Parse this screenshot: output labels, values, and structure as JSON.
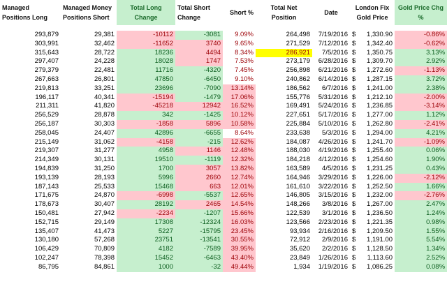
{
  "headers": {
    "long": "Managed Positions Long",
    "short": "Managed Money Positions Short",
    "total_long_change": "Total Long Change",
    "total_short_change": "Total Short Change",
    "short_pct": "Short %",
    "total_net": "Total Net Position",
    "date": "Date",
    "london_fix": "London Fix Gold Price",
    "gold_chg": "Gold Price Chg %"
  },
  "rows": [
    {
      "long": "293,879",
      "short": "29,381",
      "tlc": "-10112",
      "tsc": "-3081",
      "pct": "9.09%",
      "net": "264,498",
      "date": "7/19/2016",
      "dollar": "$",
      "price": "1,330.90",
      "chg": "-0.86%"
    },
    {
      "long": "303,991",
      "short": "32,462",
      "tlc": "-11652",
      "tsc": "3740",
      "pct": "9.65%",
      "net": "271,529",
      "date": "7/12/2016",
      "dollar": "$",
      "price": "1,342.40",
      "chg": "-0.62%"
    },
    {
      "long": "315,643",
      "short": "28,722",
      "tlc": "18236",
      "tsc": "4494",
      "pct": "8.34%",
      "net": "286,921",
      "date": "7/5/2016",
      "dollar": "$",
      "price": "1,350.75",
      "chg": "3.13%"
    },
    {
      "long": "297,407",
      "short": "24,228",
      "tlc": "18028",
      "tsc": "1747",
      "pct": "7.53%",
      "net": "273,179",
      "date": "6/28/2016",
      "dollar": "$",
      "price": "1,309.70",
      "chg": "2.92%"
    },
    {
      "long": "279,379",
      "short": "22,481",
      "tlc": "11716",
      "tsc": "-4320",
      "pct": "7.45%",
      "net": "256,898",
      "date": "6/21/2016",
      "dollar": "$",
      "price": "1,272.60",
      "chg": "-1.13%"
    },
    {
      "long": "267,663",
      "short": "26,801",
      "tlc": "47850",
      "tsc": "-6450",
      "pct": "9.10%",
      "net": "240,862",
      "date": "6/14/2016",
      "dollar": "$",
      "price": "1,287.15",
      "chg": "3.72%"
    },
    {
      "long": "219,813",
      "short": "33,251",
      "tlc": "23696",
      "tsc": "-7090",
      "pct": "13.14%",
      "net": "186,562",
      "date": "6/7/2016",
      "dollar": "$",
      "price": "1,241.00",
      "chg": "2.38%"
    },
    {
      "long": "196,117",
      "short": "40,341",
      "tlc": "-15194",
      "tsc": "-1479",
      "pct": "17.06%",
      "net": "155,776",
      "date": "5/31/2016",
      "dollar": "$",
      "price": "1,212.10",
      "chg": "-2.00%"
    },
    {
      "long": "211,311",
      "short": "41,820",
      "tlc": "-45218",
      "tsc": "12942",
      "pct": "16.52%",
      "net": "169,491",
      "date": "5/24/2016",
      "dollar": "$",
      "price": "1,236.85",
      "chg": "-3.14%"
    },
    {
      "long": "256,529",
      "short": "28,878",
      "tlc": "342",
      "tsc": "-1425",
      "pct": "10.12%",
      "net": "227,651",
      "date": "5/17/2016",
      "dollar": "$",
      "price": "1,277.00",
      "chg": "1.12%"
    },
    {
      "long": "256,187",
      "short": "30,303",
      "tlc": "-1858",
      "tsc": "5896",
      "pct": "10.58%",
      "net": "225,884",
      "date": "5/10/2016",
      "dollar": "$",
      "price": "1,262.80",
      "chg": "-2.41%"
    },
    {
      "long": "258,045",
      "short": "24,407",
      "tlc": "42896",
      "tsc": "-6655",
      "pct": "8.64%",
      "net": "233,638",
      "date": "5/3/2016",
      "dollar": "$",
      "price": "1,294.00",
      "chg": "4.21%"
    },
    {
      "long": "215,149",
      "short": "31,062",
      "tlc": "-4158",
      "tsc": "-215",
      "pct": "12.62%",
      "net": "184,087",
      "date": "4/26/2016",
      "dollar": "$",
      "price": "1,241.70",
      "chg": "-1.09%"
    },
    {
      "long": "219,307",
      "short": "31,277",
      "tlc": "4958",
      "tsc": "1146",
      "pct": "12.48%",
      "net": "188,030",
      "date": "4/19/2016",
      "dollar": "$",
      "price": "1,255.40",
      "chg": "0.06%"
    },
    {
      "long": "214,349",
      "short": "30,131",
      "tlc": "19510",
      "tsc": "-1119",
      "pct": "12.32%",
      "net": "184,218",
      "date": "4/12/2016",
      "dollar": "$",
      "price": "1,254.60",
      "chg": "1.90%"
    },
    {
      "long": "194,839",
      "short": "31,250",
      "tlc": "1700",
      "tsc": "3057",
      "pct": "13.82%",
      "net": "163,589",
      "date": "4/5/2016",
      "dollar": "$",
      "price": "1,231.25",
      "chg": "0.43%"
    },
    {
      "long": "193,139",
      "short": "28,193",
      "tlc": "5996",
      "tsc": "2660",
      "pct": "12.74%",
      "net": "164,946",
      "date": "3/29/2016",
      "dollar": "$",
      "price": "1,226.00",
      "chg": "-2.12%"
    },
    {
      "long": "187,143",
      "short": "25,533",
      "tlc": "15468",
      "tsc": "663",
      "pct": "12.01%",
      "net": "161,610",
      "date": "3/22/2016",
      "dollar": "$",
      "price": "1,252.50",
      "chg": "1.66%"
    },
    {
      "long": "171,675",
      "short": "24,870",
      "tlc": "-6998",
      "tsc": "-5537",
      "pct": "12.65%",
      "net": "146,805",
      "date": "3/15/2016",
      "dollar": "$",
      "price": "1,232.00",
      "chg": "-2.76%"
    },
    {
      "long": "178,673",
      "short": "30,407",
      "tlc": "28192",
      "tsc": "2465",
      "pct": "14.54%",
      "net": "148,266",
      "date": "3/8/2016",
      "dollar": "$",
      "price": "1,267.00",
      "chg": "2.47%"
    },
    {
      "long": "150,481",
      "short": "27,942",
      "tlc": "-2234",
      "tsc": "-1207",
      "pct": "15.66%",
      "net": "122,539",
      "date": "3/1/2016",
      "dollar": "$",
      "price": "1,236.50",
      "chg": "1.24%"
    },
    {
      "long": "152,715",
      "short": "29,149",
      "tlc": "17308",
      "tsc": "-12324",
      "pct": "16.03%",
      "net": "123,566",
      "date": "2/23/2016",
      "dollar": "$",
      "price": "1,221.35",
      "chg": "0.98%"
    },
    {
      "long": "135,407",
      "short": "41,473",
      "tlc": "5227",
      "tsc": "-15795",
      "pct": "23.45%",
      "net": "93,934",
      "date": "2/16/2016",
      "dollar": "$",
      "price": "1,209.50",
      "chg": "1.55%"
    },
    {
      "long": "130,180",
      "short": "57,268",
      "tlc": "23751",
      "tsc": "-13541",
      "pct": "30.55%",
      "net": "72,912",
      "date": "2/9/2016",
      "dollar": "$",
      "price": "1,191.00",
      "chg": "5.54%"
    },
    {
      "long": "106,429",
      "short": "70,809",
      "tlc": "4182",
      "tsc": "-7589",
      "pct": "39.95%",
      "net": "35,620",
      "date": "2/2/2016",
      "dollar": "$",
      "price": "1,128.50",
      "chg": "1.34%"
    },
    {
      "long": "102,247",
      "short": "78,398",
      "tlc": "15452",
      "tsc": "-6463",
      "pct": "43.40%",
      "net": "23,849",
      "date": "1/26/2016",
      "dollar": "$",
      "price": "1,113.60",
      "chg": "2.52%"
    },
    {
      "long": "86,795",
      "short": "84,861",
      "tlc": "1000",
      "tsc": "-32",
      "pct": "49.44%",
      "net": "1,934",
      "date": "1/19/2016",
      "dollar": "$",
      "price": "1,086.25",
      "chg": "0.08%"
    }
  ],
  "colors": {
    "positive_fill": "#c6efce",
    "positive_text": "#0b5d1e",
    "negative_fill": "#ffc7ce",
    "negative_text": "#9c0006",
    "highlight_fill": "#ffff00"
  }
}
